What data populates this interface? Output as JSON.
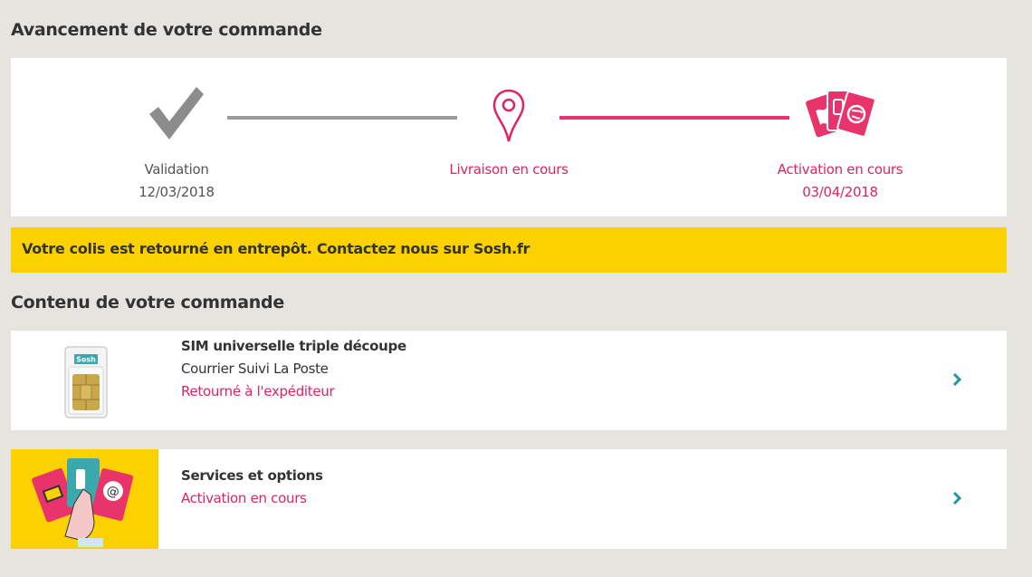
{
  "order_progress": {
    "title": "Avancement de votre commande",
    "steps": [
      {
        "icon": "check-icon",
        "label": "Validation",
        "date": "12/03/2018",
        "status": "done",
        "color": "#8c8c8c"
      },
      {
        "icon": "map-pin-icon",
        "label": "Livraison en cours",
        "date": "",
        "status": "current",
        "color": "#e0245e"
      },
      {
        "icon": "cards-icon",
        "label": "Activation en cours",
        "date": "03/04/2018",
        "status": "current",
        "color": "#e0245e"
      }
    ],
    "connector_colors": [
      "#9b9b9b",
      "#e8336b"
    ]
  },
  "alert": {
    "message": "Votre colis est retourné en entrepôt. Contactez nous sur Sosh.fr",
    "background": "#fcd100"
  },
  "order_content": {
    "title": "Contenu de votre commande",
    "items": [
      {
        "image": "sim-card-image",
        "sim_brand": "Sosh",
        "name": "SIM universelle triple découpe",
        "shipping": "Courrier Suivi La Poste",
        "status": "Retourné à l'expéditeur"
      },
      {
        "image": "services-illustration",
        "name": "Services et options",
        "status": "Activation en cours"
      }
    ]
  },
  "colors": {
    "accent": "#e0245e",
    "chevron": "#1a9aa0",
    "page_background": "#e6e4de"
  }
}
